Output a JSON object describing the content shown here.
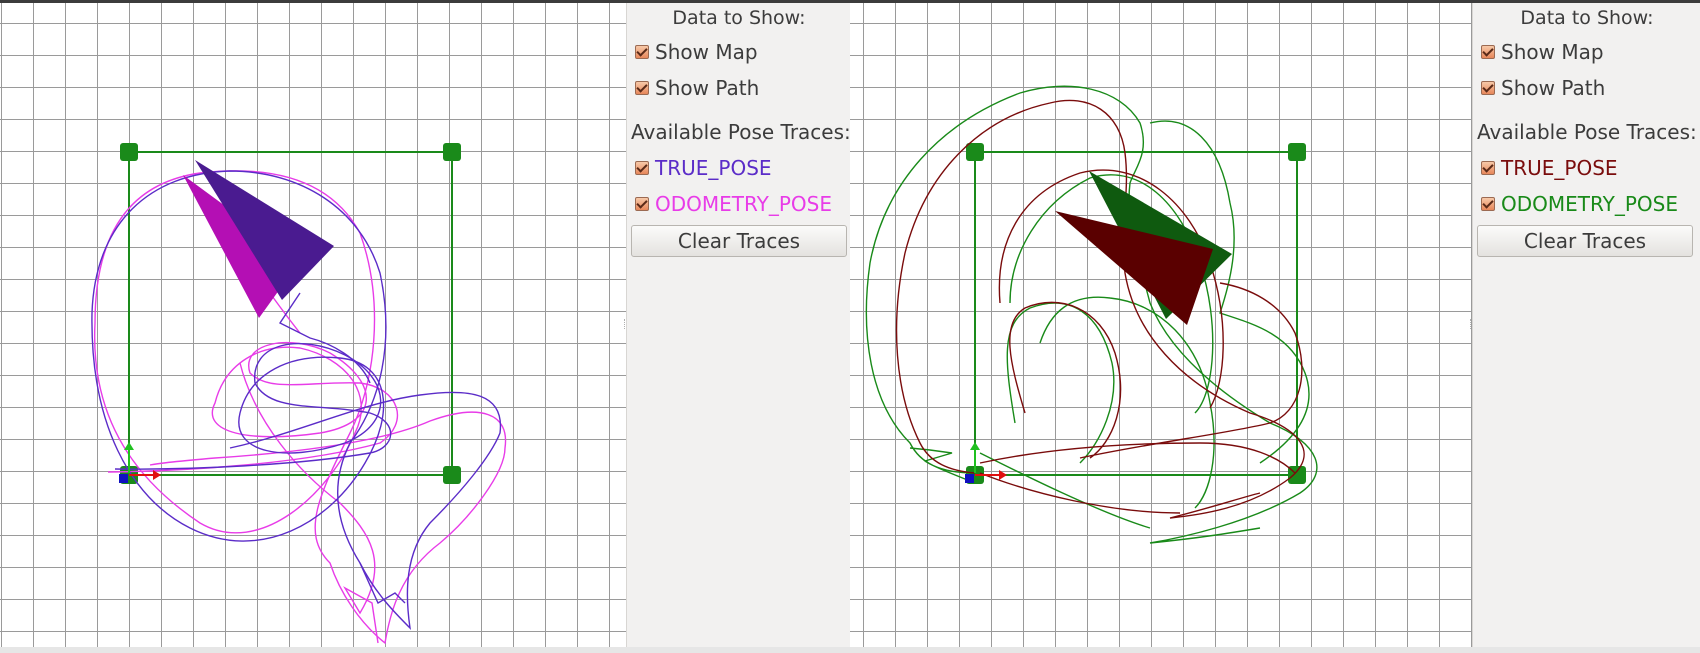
{
  "colors": {
    "grid": "#9a9a9a",
    "map_green": "#1a8a1a",
    "panel_bg": "#f2f1f0",
    "left_true": "#5b2cc8",
    "left_odom": "#e83ce8",
    "right_true": "#7a0c0c",
    "right_odom": "#198a19"
  },
  "left_panel": {
    "title": "Data to Show:",
    "show_map_label": "Show Map",
    "show_path_label": "Show Path",
    "traces_label": "Available Pose Traces:",
    "trace_true_label": "TRUE_POSE",
    "trace_odom_label": "ODOMETRY_POSE",
    "true_color": "#5b2cc8",
    "odom_color": "#e83ce8",
    "clear_label": "Clear Traces"
  },
  "right_panel": {
    "title": "Data to Show:",
    "show_map_label": "Show Map",
    "show_path_label": "Show Path",
    "traces_label": "Available Pose Traces:",
    "trace_true_label": "TRUE_POSE",
    "trace_odom_label": "ODOMETRY_POSE",
    "true_color": "#7a0c0c",
    "odom_color": "#198a19",
    "clear_label": "Clear Traces"
  },
  "icons": {
    "checkbox": "checkbox-checked-icon",
    "origin_axes": "origin-axes-icon",
    "pose_arrow": "pose-triangle-icon",
    "waypoint": "waypoint-square-icon"
  }
}
